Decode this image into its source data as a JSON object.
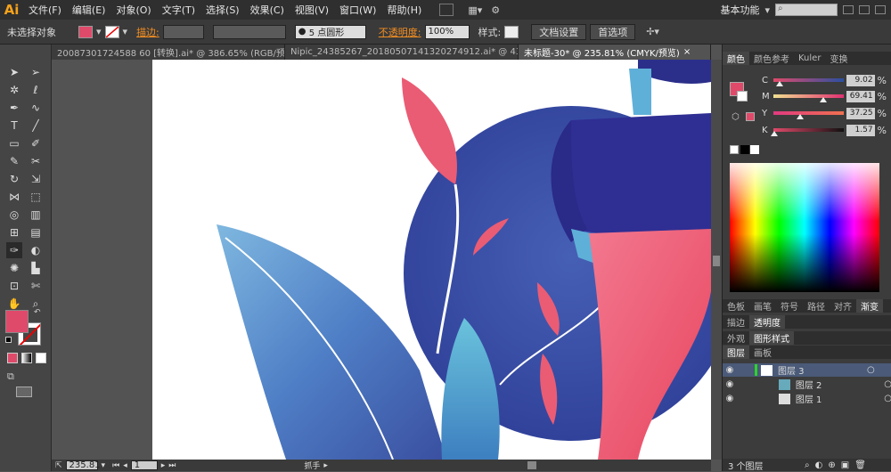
{
  "app": {
    "logo": "Ai"
  },
  "menu": [
    "文件(F)",
    "编辑(E)",
    "对象(O)",
    "文字(T)",
    "选择(S)",
    "效果(C)",
    "视图(V)",
    "窗口(W)",
    "帮助(H)"
  ],
  "workspace": "基本功能",
  "control": {
    "selection_status": "未选择对象",
    "stroke_label": "描边:",
    "brush_value": "5 点圆形",
    "opacity_label": "不透明度:",
    "opacity_value": "100%",
    "style_label": "样式:",
    "doc_setup_button": "文档设置",
    "prefs_button": "首选项"
  },
  "tabs": [
    {
      "label": "20087301724588 60 [转换].ai* @ 386.65% (RGB/预..."
    },
    {
      "label": "Nipic_24385267_20180507141320274912.ai* @ 43..."
    },
    {
      "label": "未标题-30* @ 235.81% (CMYK/预览)"
    }
  ],
  "status": {
    "zoom": "235.81",
    "page": "1",
    "tool_name": "抓手"
  },
  "color_panel": {
    "tabs": [
      "颜色",
      "颜色参考",
      "Kuler",
      "变换"
    ],
    "channels": [
      {
        "name": "C",
        "value": "9.02",
        "unit": "%",
        "level": 0.09
      },
      {
        "name": "M",
        "value": "69.41",
        "unit": "%",
        "level": 0.69
      },
      {
        "name": "Y",
        "value": "37.25",
        "unit": "%",
        "level": 0.37
      },
      {
        "name": "K",
        "value": "1.57",
        "unit": "%",
        "level": 0.02
      }
    ]
  },
  "panel_rows": {
    "row1": [
      "色板",
      "画笔",
      "符号",
      "路径",
      "对齐",
      "渐变"
    ],
    "row2": [
      "描边",
      "透明度"
    ],
    "row3": [
      "外观",
      "图形样式"
    ],
    "row4": [
      "图层",
      "画板"
    ]
  },
  "layers": [
    {
      "name": "图层 3"
    },
    {
      "name": "图层 2"
    },
    {
      "name": "图层 1"
    }
  ],
  "layers_footer": "3 个图层",
  "colors": {
    "fill": "#e04a6a",
    "accent_orange": "#f28e22",
    "canvas_blue": "#3b4fa8",
    "canvas_pink": "#ef5a78",
    "canvas_teal": "#5db5d3"
  }
}
